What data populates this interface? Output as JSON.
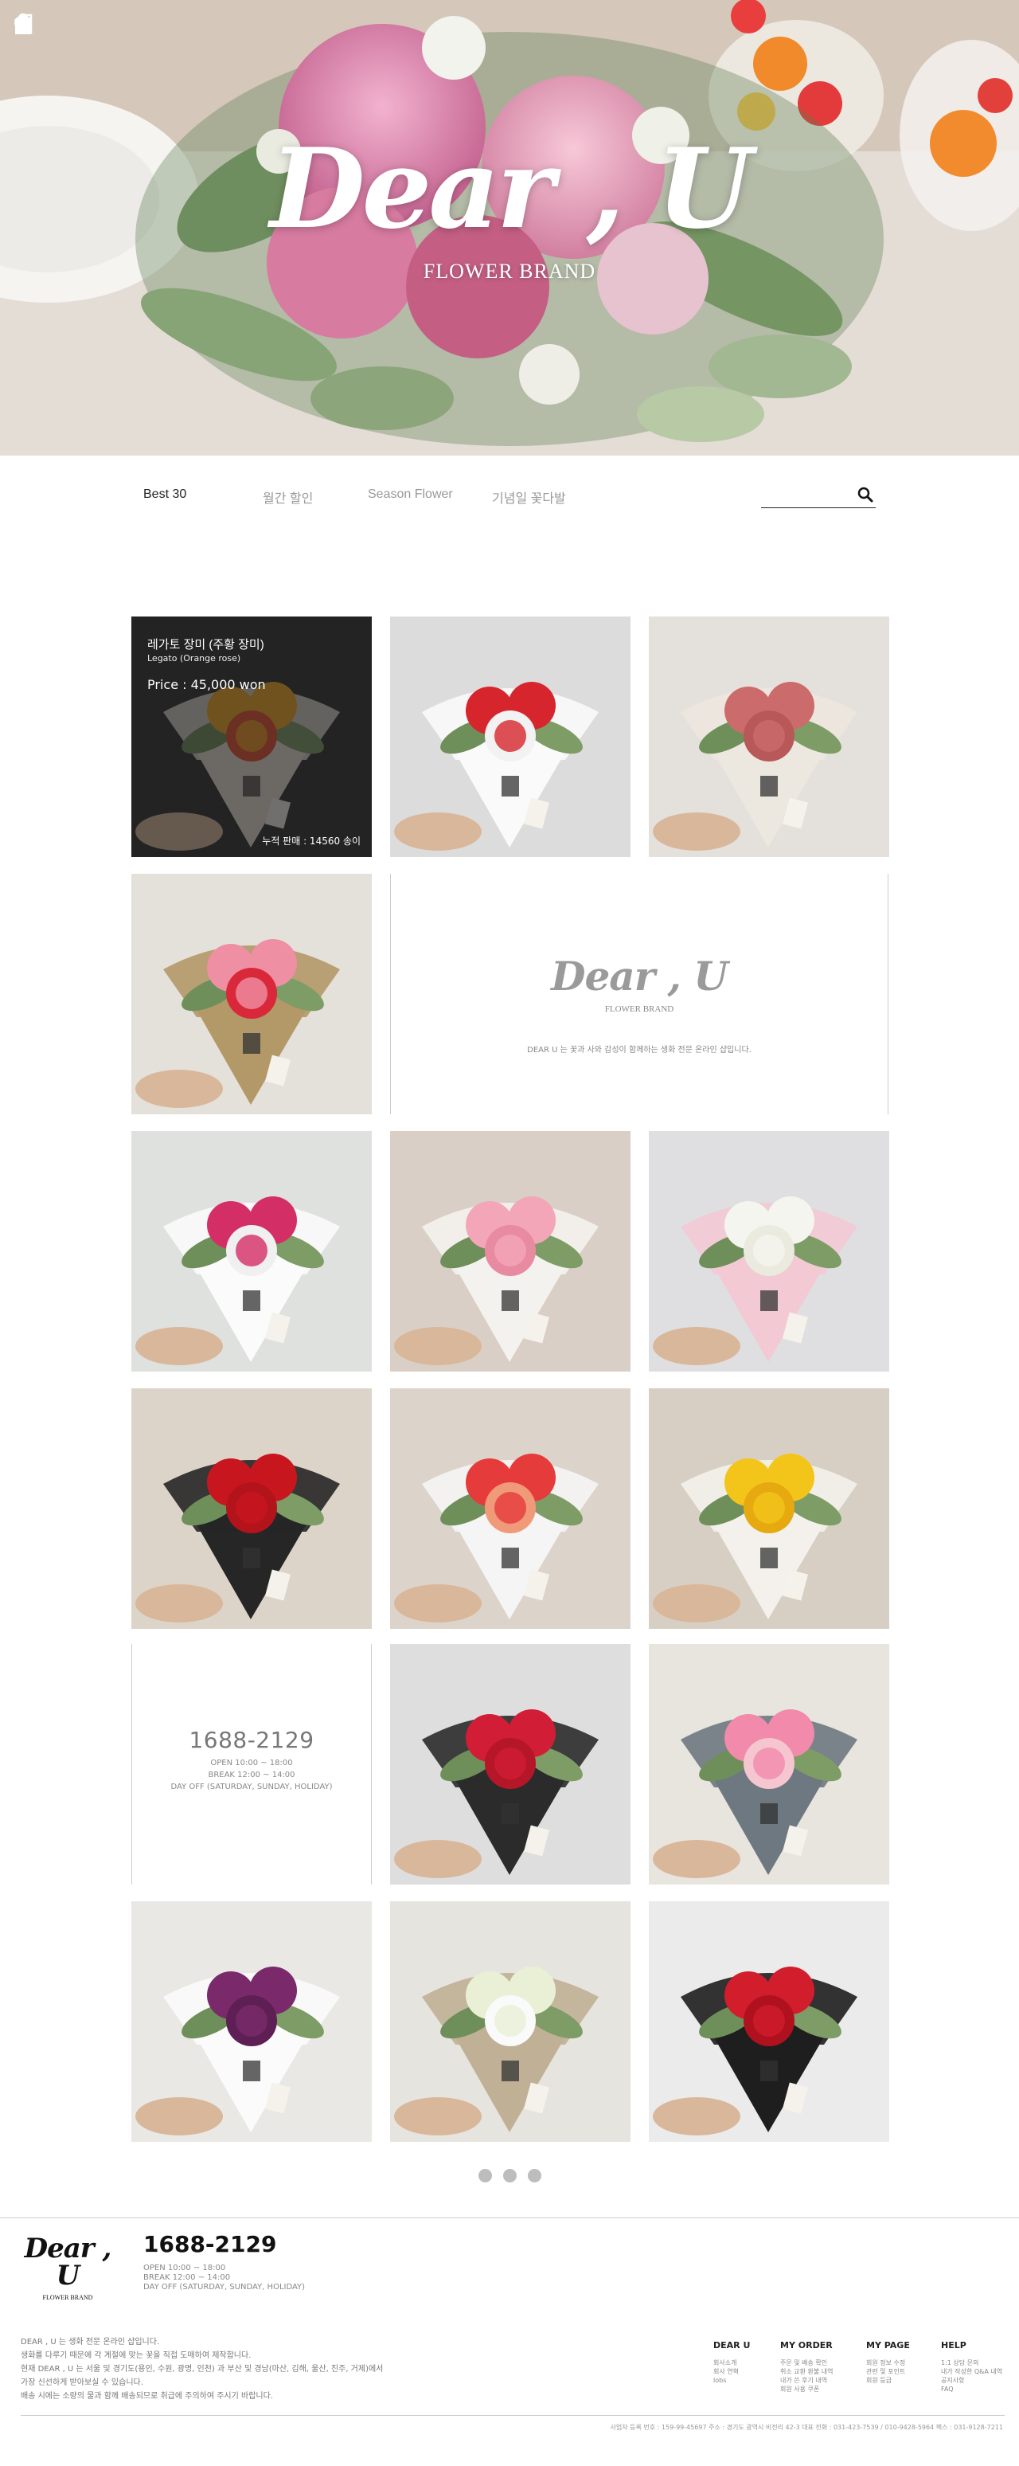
{
  "hero": {
    "logo": "Dear , U",
    "subtitle": "FLOWER BRAND",
    "icons": [
      "user-icon",
      "bag-icon",
      "heart-icon",
      "login-icon"
    ]
  },
  "nav": {
    "tabs": [
      "Best 30",
      "월간 할인",
      "Season Flower",
      "기념일 꽃다발"
    ],
    "active": 0,
    "search_placeholder": ""
  },
  "featured": {
    "name": "레가토 장미 (주황 장미)",
    "name_en": "Legato (Orange rose)",
    "price": "Price : 45,000 won",
    "sold": "누적 판매 : 14560 송이"
  },
  "brand_card": {
    "logo": "Dear , U",
    "subtitle": "FLOWER BRAND",
    "description": "DEAR U 는 꽃과 사와 감성이 함께하는 생화 전문 온라인 샵입니다."
  },
  "contact_card": {
    "phone": "1688-2129",
    "hours": [
      "OPEN 10:00 ~ 18:00",
      "BREAK 12:00 ~ 14:00",
      "DAY OFF (SATURDAY, SUNDAY, HOLIDAY)"
    ]
  },
  "products": [
    {
      "bg": "#2b2b2b",
      "paper": "#e9e2d8",
      "flower": "#f2a51e",
      "accent": "#e84a2a"
    },
    {
      "bg": "#dcdcdc",
      "paper": "#fafafa",
      "flower": "#d6252d",
      "accent": "#f2f2f2"
    },
    {
      "bg": "#e4e1dc",
      "paper": "#ece7df",
      "flower": "#cc6b6b",
      "accent": "#b95858"
    },
    {
      "bg": "#e4e0da",
      "paper": "#b39868",
      "flower": "#ef8fa4",
      "accent": "#d9283a"
    },
    {
      "bg": "#dfe1df",
      "paper": "#fbfbfb",
      "flower": "#d42e67",
      "accent": "#f0f0f0"
    },
    {
      "bg": "#d9cfc6",
      "paper": "#f4f2ee",
      "flower": "#f3a6b8",
      "accent": "#e88aa0"
    },
    {
      "bg": "#dfdfe2",
      "paper": "#f3c9d4",
      "flower": "#f5f5ef",
      "accent": "#eaeadf"
    },
    {
      "bg": "#ddd4c9",
      "paper": "#262626",
      "flower": "#c8161f",
      "accent": "#b3131b"
    },
    {
      "bg": "#dcd4ca",
      "paper": "#f5f5f5",
      "flower": "#e63b3b",
      "accent": "#f09a7a"
    },
    {
      "bg": "#d8cfc4",
      "paper": "#f4f1ec",
      "flower": "#f3c41a",
      "accent": "#e6a90f"
    },
    {
      "bg": "#dedede",
      "paper": "#2b2b2b",
      "flower": "#d11d35",
      "accent": "#b51628"
    },
    {
      "bg": "#e8e4de",
      "paper": "#6e7880",
      "flower": "#f18aab",
      "accent": "#f5c6cf"
    },
    {
      "bg": "#eae8e5",
      "paper": "#fbfbfb",
      "flower": "#7a2a6a",
      "accent": "#5e1f54"
    },
    {
      "bg": "#e6e4de",
      "paper": "#c0b096",
      "flower": "#e9f0d6",
      "accent": "#fafafa"
    },
    {
      "bg": "#ebebeb",
      "paper": "#1e1e1e",
      "flower": "#d11d2c",
      "accent": "#b0111e"
    }
  ],
  "pagination": {
    "pages": 3,
    "current": 0
  },
  "footer": {
    "logo": "Dear , U",
    "subtitle": "FLOWER BRAND",
    "phone": "1688-2129",
    "hours": [
      "OPEN 10:00 ~ 18:00",
      "BREAK 12:00 ~ 14:00",
      "DAY OFF (SATURDAY, SUNDAY, HOLIDAY)"
    ],
    "about": [
      "DEAR , U 는 생화 전문 온라인 샵입니다.",
      "생화를 다루기 때문에 각 계절에 맞는 꽃을 직접 도매하여 제작합니다.",
      "현재 DEAR , U 는 서울 및 경기도(용인, 수원, 광명, 인천) 과 부산 및 경남(마산, 김해, 울산, 진주, 거제)에서",
      "가장 신선하게 받아보실 수 있습니다.",
      "배송 시에는 소량의 물과 함께 배송되므로 취급에 주의하여 주시기 바랍니다."
    ],
    "columns": [
      {
        "title": "DEAR U",
        "items": [
          "회사소개",
          "회사 연혁",
          "lobs"
        ]
      },
      {
        "title": "MY ORDER",
        "items": [
          "주문 및 배송 확인",
          "취소 교환 환불 내역",
          "내가 쓴 후기 내역",
          "회원 사용 쿠폰"
        ]
      },
      {
        "title": "MY PAGE",
        "items": [
          "회원 정보 수정",
          "관련 및 포인트",
          "회원 등급"
        ]
      },
      {
        "title": "HELP",
        "items": [
          "1:1 상담 문의",
          "내가 작성한 Q&A 내역",
          "공지사항",
          "FAQ"
        ]
      }
    ],
    "bottom": "사업자 등록 번호 : 159-99-45697   주소 : 경기도 광역시 비전리 42-3   대표 전화 : 031-423-7539 / 010-9428-5964   팩스 : 031-9128-7211"
  }
}
